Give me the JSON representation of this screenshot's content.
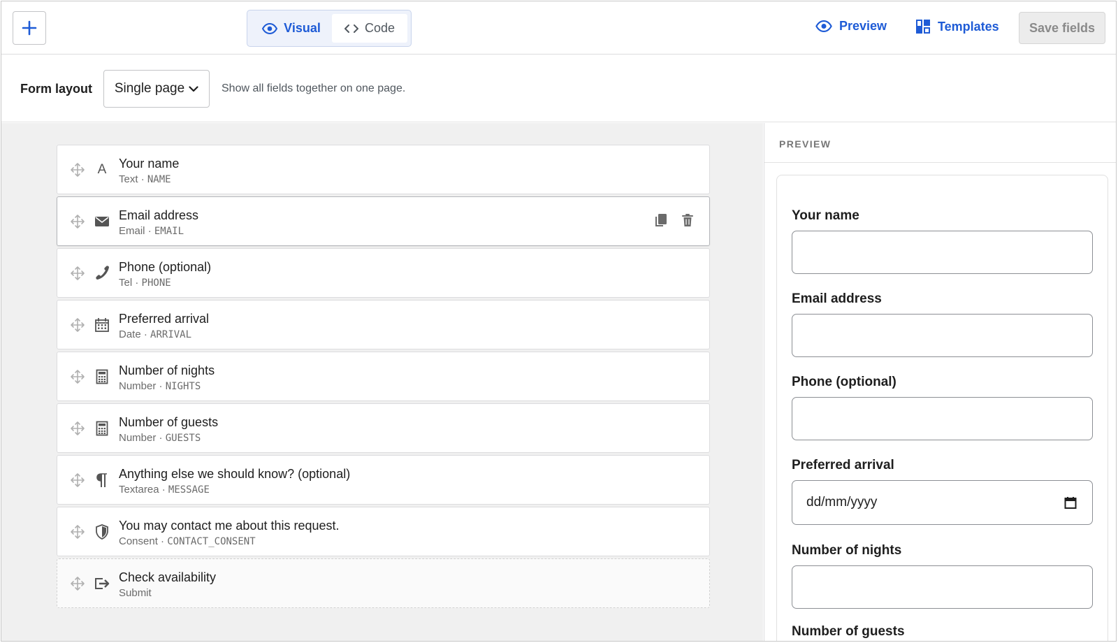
{
  "toolbar": {
    "add_label": "+",
    "modes": [
      {
        "label": "Visual",
        "icon": "eye-icon",
        "active": true
      },
      {
        "label": "Code",
        "icon": "code-icon",
        "active": false
      }
    ],
    "preview_label": "Preview",
    "templates_label": "Templates",
    "save_label": "Save fields",
    "accent_color": "#1e5bd6"
  },
  "layout": {
    "label": "Form layout",
    "selected": "Single page",
    "description": "Show all fields together on one page."
  },
  "fields": [
    {
      "title": "Your name",
      "type": "Text",
      "key": "NAME",
      "icon": "text-icon"
    },
    {
      "title": "Email address",
      "type": "Email",
      "key": "EMAIL",
      "icon": "envelope-icon",
      "selected": true
    },
    {
      "title": "Phone (optional)",
      "type": "Tel",
      "key": "PHONE",
      "icon": "phone-icon"
    },
    {
      "title": "Preferred arrival",
      "type": "Date",
      "key": "ARRIVAL",
      "icon": "calendar-icon"
    },
    {
      "title": "Number of nights",
      "type": "Number",
      "key": "NIGHTS",
      "icon": "calculator-icon"
    },
    {
      "title": "Number of guests",
      "type": "Number",
      "key": "GUESTS",
      "icon": "calculator-icon"
    },
    {
      "title": "Anything else we should know? (optional)",
      "type": "Textarea",
      "key": "MESSAGE",
      "icon": "paragraph-icon"
    },
    {
      "title": "You may contact me about this request.",
      "type": "Consent",
      "key": "CONTACT_CONSENT",
      "icon": "shield-icon"
    },
    {
      "title": "Check availability",
      "type": "Submit",
      "key": "",
      "icon": "submit-icon"
    }
  ],
  "separator": "·",
  "preview": {
    "heading": "PREVIEW",
    "labels": [
      "Your name",
      "Email address",
      "Phone (optional)",
      "Preferred arrival",
      "Number of nights",
      "Number of guests"
    ],
    "date_placeholder": "dd/mm/yyyy"
  }
}
